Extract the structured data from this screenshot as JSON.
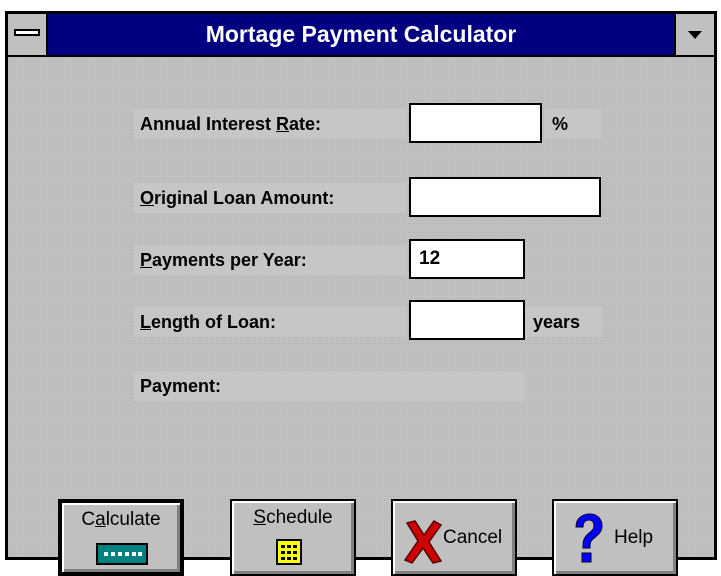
{
  "window": {
    "title": "Mortage Payment Calculator"
  },
  "form": {
    "interest_rate": {
      "label_prefix": "Annual Interest ",
      "label_mnemonic": "R",
      "label_suffix": "ate:",
      "value": "",
      "unit": "%"
    },
    "loan_amount": {
      "label_mnemonic": "O",
      "label_suffix": "riginal Loan Amount:",
      "value": ""
    },
    "payments_per_year": {
      "label_mnemonic": "P",
      "label_suffix": "ayments per Year:",
      "value": "12"
    },
    "loan_length": {
      "label_mnemonic": "L",
      "label_suffix": "ength of Loan:",
      "value": "",
      "unit": "years"
    },
    "payment": {
      "label": "Payment:",
      "value": ""
    }
  },
  "buttons": {
    "calculate": {
      "pre": "C",
      "mnemonic": "a",
      "post": "lculate"
    },
    "schedule": {
      "mnemonic": "S",
      "post": "chedule"
    },
    "cancel": {
      "label": "Cancel"
    },
    "help": {
      "label": "Help"
    }
  },
  "colors": {
    "title_bar": "#000080",
    "face": "#c0c0c0",
    "cancel_x": "#cc0000",
    "help_q": "#0000ff"
  }
}
